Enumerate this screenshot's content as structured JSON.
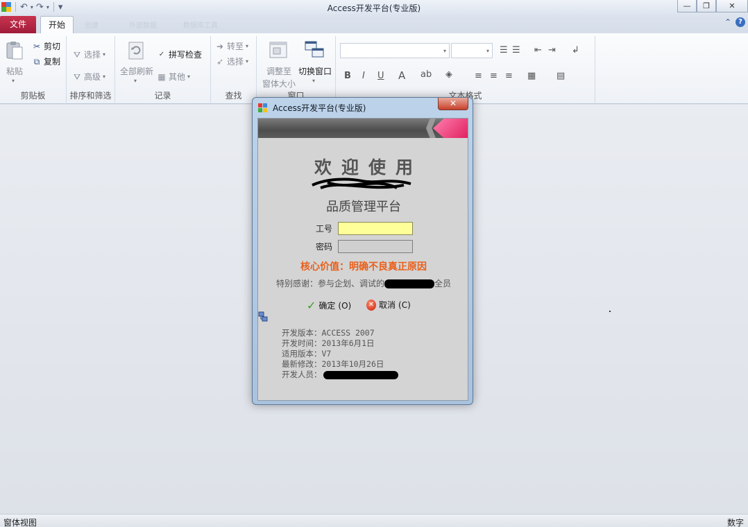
{
  "window": {
    "title": "Access开发平台(专业版)",
    "controls": {
      "minimize": "—",
      "restore": "❐",
      "close": "✕"
    }
  },
  "qat": {
    "undo": "↶",
    "redo": "↷",
    "customize": "▾"
  },
  "tabs": {
    "file": "文件",
    "home": "开始",
    "ghost": [
      "创建",
      "外部数据",
      "数据库工具"
    ]
  },
  "help_icons": {
    "collapse": "⌃",
    "help": "?"
  },
  "ribbon": {
    "clipboard": {
      "label": "剪贴板",
      "paste": "粘贴",
      "cut": "剪切",
      "copy": "复制"
    },
    "sort_filter": {
      "label": "排序和筛选",
      "select": "选择",
      "advanced": "高级"
    },
    "records": {
      "label": "记录",
      "refresh_all": "全部刷新",
      "spelling": "拼写检查",
      "other": "其他"
    },
    "find": {
      "label": "查找",
      "goto": "转至",
      "select": "选择"
    },
    "window": {
      "label": "窗口",
      "fit_window_1": "调整至",
      "fit_window_2": "窗体大小",
      "switch_window": "切换窗口"
    },
    "text_format": {
      "label": "文本格式",
      "bold": "B",
      "italic": "I",
      "underline": "U"
    }
  },
  "statusbar": {
    "left": "窗体视图",
    "right": "数字"
  },
  "dialog": {
    "title": "Access开发平台(专业版)",
    "close": "✕",
    "welcome": "欢迎使用",
    "platform": "品质管理平台",
    "employee_id_label": "工号",
    "employee_id_value": "",
    "password_label": "密码",
    "password_value": "",
    "core_value": "核心价值：明确不良真正原因",
    "thanks_prefix": "特别感谢：参与企划、调试的",
    "thanks_suffix": "全员",
    "ok_button": "确定",
    "ok_key": "(O)",
    "cancel_button": "取消",
    "cancel_key": "(C)",
    "info": [
      "开发版本：ACCESS 2007",
      "开发时间：2013年6月1日",
      "适用版本：V7",
      "最新修改：2013年10月26日",
      "开发人员："
    ]
  }
}
